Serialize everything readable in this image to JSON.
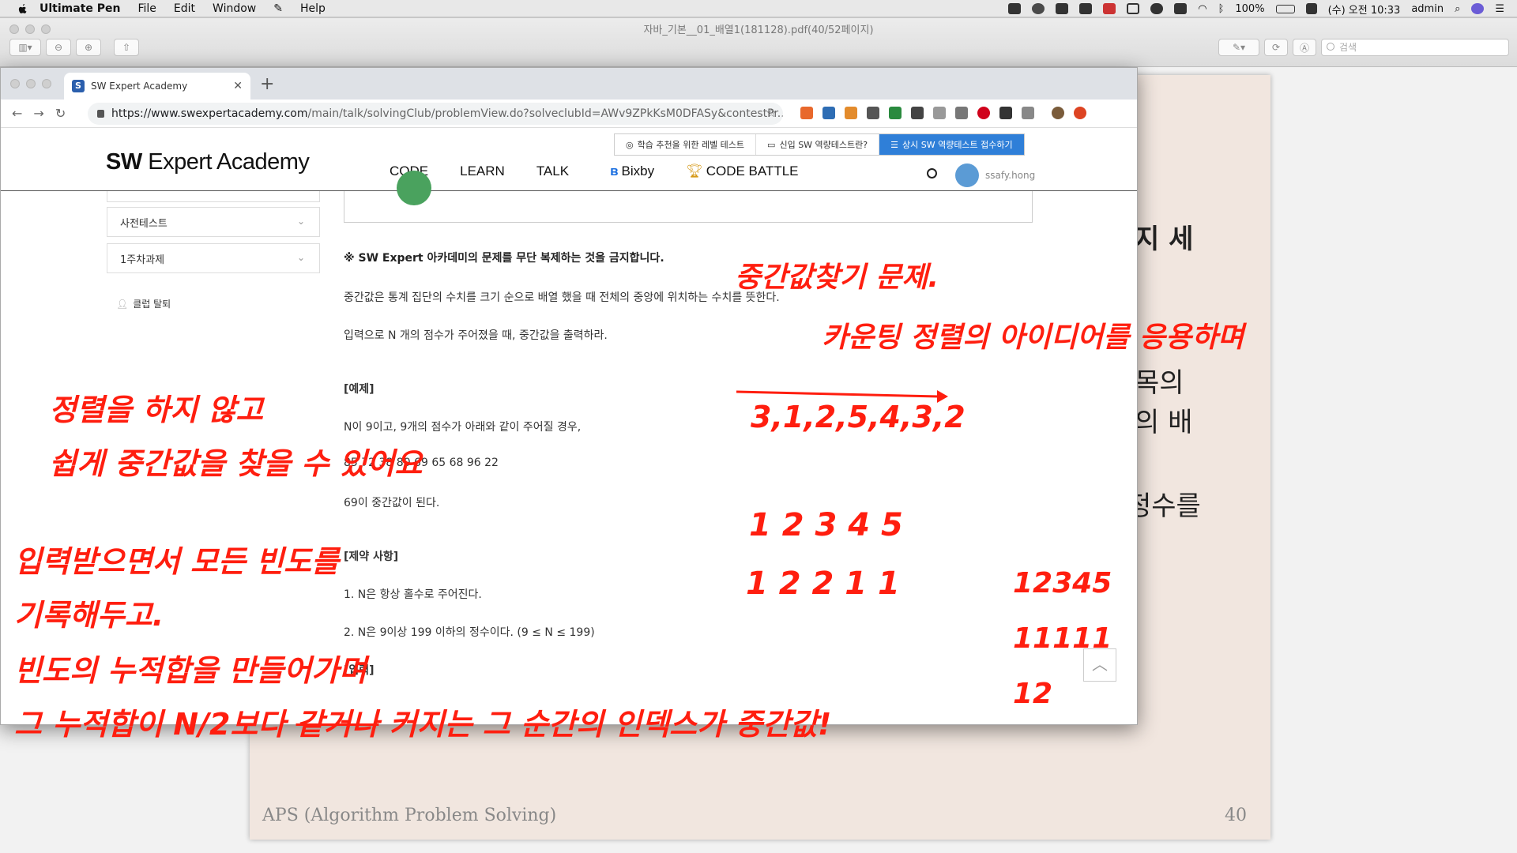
{
  "menubar": {
    "app": "Ultimate Pen",
    "items": [
      "File",
      "Edit",
      "Window",
      "Help"
    ],
    "battery": "100%",
    "clock": "(수) 오전 10:33",
    "user": "admin"
  },
  "pdf": {
    "title": "자바_기본__01_배열1(181128).pdf(40/52페이지)",
    "search_placeholder": "검색",
    "page_fragments": [
      "지 세",
      "목의",
      "의 배",
      "정수를"
    ],
    "footer_left": "APS (Algorithm Problem Solving)",
    "footer_right": "40"
  },
  "browser": {
    "tab_title": "SW Expert Academy",
    "tab_favicon": "S",
    "url_host": "https://www.swexpertacademy.com",
    "url_path": "/main/talk/solvingClub/problemView.do?solveclubId=AWv9ZPkKsM0DFASy&contestPr..."
  },
  "site": {
    "logo_bold": "SW",
    "logo_rest": " Expert Academy",
    "top_buttons": [
      "학습 추천을 위한 레벨 테스트",
      "신입 SW 역량테스트란?",
      "상시 SW 역량테스트 접수하기"
    ],
    "nav": [
      "CODE",
      "LEARN",
      "TALK"
    ],
    "nav_bixby": "Bixby",
    "nav_battle": "CODE BATTLE",
    "username": "ssafy.hong"
  },
  "sidebar": {
    "items": [
      "사전테스트",
      "1주차과제"
    ],
    "leave": "클럽 탈퇴"
  },
  "problem": {
    "warning": "※ SW Expert 아카데미의 문제를 무단 복제하는 것을 금지합니다.",
    "desc1": "중간값은 통계 집단의 수치를 크기 순으로 배열 했을 때 전체의 중앙에 위치하는 수치를 뜻한다.",
    "desc2": "입력으로 N 개의 점수가 주어졌을 때, 중간값을 출력하라.",
    "example_title": "[예제]",
    "example_desc": "N이 9이고, 9개의 점수가 아래와 같이 주어질 경우,",
    "example_numbers": "85 72 38 80 69 65 68 96 22",
    "example_result": "69이 중간값이 된다.",
    "constraints_title": "[제약 사항]",
    "constraint1": "1. N은 항상 홀수로 주어진다.",
    "constraint2": "2. N은 9이상 199 이하의 정수이다. (9 ≤ N ≤ 199)",
    "cut": "[입력]"
  },
  "annotations": {
    "a1": "중간값찾기 문제.",
    "a2": "카운팅 정렬의 아이디어를 응용하며",
    "a3": "3,1,2,5,4,3,2",
    "a4": "1 2 3 4 5",
    "a5": "1 2 2 1 1",
    "a6": "12345",
    "a7": "11111",
    "a8": "12",
    "a9": "정렬을 하지 않고",
    "a10": "쉽게 중간값을 찾을 수 있어요",
    "a11": "입력받으면서 모든 빈도를",
    "a12": "기록해두고.",
    "a13": "빈도의 누적합을 만들어가며",
    "a14_pre": "그 누적합이 N/2보다 ",
    "a14_strike": "같거나",
    "a14_post": " 커지는 그 순간의 인덱스가 중간값!"
  }
}
